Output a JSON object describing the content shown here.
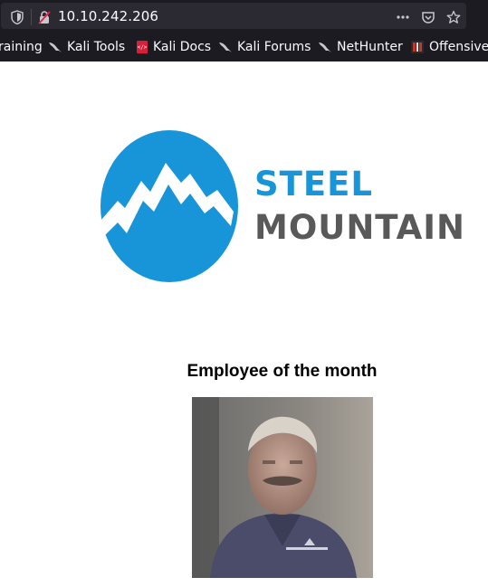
{
  "browser": {
    "url": "10.10.242.206",
    "icons": [
      "shield-icon",
      "insecure-lock-icon",
      "more-actions-icon",
      "pocket-icon",
      "bookmark-star-icon"
    ]
  },
  "bookmarks": [
    {
      "label": "raining",
      "icon": "none"
    },
    {
      "label": "Kali Tools",
      "icon": "kali-dragon-icon"
    },
    {
      "label": "Kali Docs",
      "icon": "kali-docs-icon"
    },
    {
      "label": "Kali Forums",
      "icon": "kali-dragon-icon"
    },
    {
      "label": "NetHunter",
      "icon": "kali-dragon-icon"
    },
    {
      "label": "Offensive",
      "icon": "offensive-security-icon"
    }
  ],
  "page": {
    "logo_line1": "STEEL",
    "logo_line2": "MOUNTAIN",
    "heading": "Employee of the month"
  },
  "colors": {
    "brand_blue": "#1894d8",
    "brand_gray": "#595959",
    "chrome_bg": "#1c1b22",
    "urlbar_bg": "#2b2a33"
  }
}
